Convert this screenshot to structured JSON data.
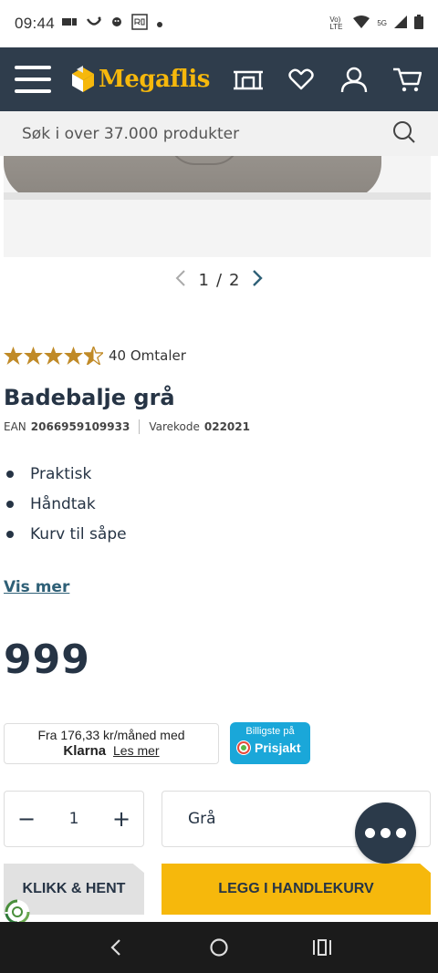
{
  "status_bar": {
    "time": "09:44",
    "network_label": "Vo) LTE",
    "signal_label": "5G"
  },
  "header": {
    "logo_text": "Megaflis"
  },
  "search": {
    "placeholder": "Søk i over 37.000 produkter"
  },
  "gallery": {
    "current": "1",
    "separator": "/",
    "total": "2"
  },
  "product": {
    "rating": 4.5,
    "reviews_label": "40 Omtaler",
    "title": "Badebalje grå",
    "ean_label": "EAN",
    "ean": "2066959109933",
    "code_label": "Varekode",
    "code": "022021",
    "features": [
      "Praktisk",
      "Håndtak",
      "Kurv til såpe"
    ],
    "show_more": "Vis mer",
    "price": "999"
  },
  "klarna": {
    "line1": "Fra 176,33 kr/måned med",
    "brand": "Klarna",
    "link": "Les mer"
  },
  "prisjakt": {
    "line1": "Billigste på",
    "brand": "Prisjakt"
  },
  "quantity": {
    "minus": "−",
    "value": "1",
    "plus": "+"
  },
  "variant": {
    "selected": "Grå"
  },
  "actions": {
    "click_collect": "KLIKK & HENT",
    "add_to_cart": "LEGG I HANDLEKURV"
  },
  "colors": {
    "header_bg": "#2f3d4c",
    "brand_yellow": "#f6b80c",
    "text_dark": "#263445",
    "star_gold": "#c08a27",
    "link_teal": "#2f6077",
    "prisjakt_blue": "#1aa7d9"
  }
}
